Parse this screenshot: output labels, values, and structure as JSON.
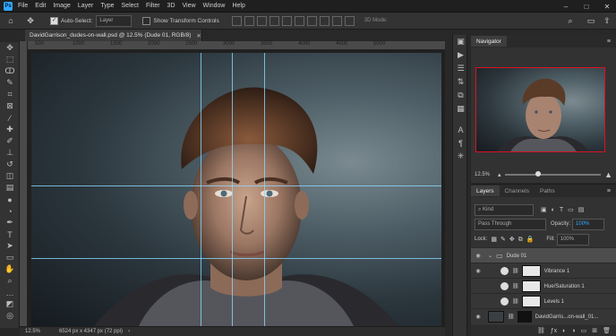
{
  "menu": {
    "items": [
      "File",
      "Edit",
      "Image",
      "Layer",
      "Type",
      "Select",
      "Filter",
      "3D",
      "View",
      "Window",
      "Help"
    ]
  },
  "options": {
    "auto_select_label": "Auto-Select:",
    "auto_select_value": "Layer",
    "transform_label": "Show Transform Controls",
    "mode_3d": "3D Mode:"
  },
  "document": {
    "tab_title": "DavidGarrison_dudes-on-wall.psd @ 12.5% (Dude 01, RGB/8)",
    "ruler_labels": [
      "500",
      "1000",
      "1500",
      "2000",
      "2500",
      "3000",
      "3500",
      "4000",
      "4500",
      "5000"
    ],
    "zoom": "12.5%",
    "dimensions": "6524 px x 4347 px (72 ppi)"
  },
  "navigator": {
    "tab_label": "Navigator",
    "zoom": "12.5%"
  },
  "layers": {
    "tabs": [
      "Layers",
      "Channels",
      "Paths"
    ],
    "filter_kind": "Kind",
    "blend_mode": "Pass Through",
    "opacity_label": "Opacity:",
    "opacity_value": "100%",
    "lock_label": "Lock:",
    "fill_label": "Fill:",
    "fill_value": "100%",
    "items": [
      {
        "name": "Dude 01"
      },
      {
        "name": "Vibrance 1"
      },
      {
        "name": "Hue/Saturation 1"
      },
      {
        "name": "Levels 1"
      },
      {
        "name": "DavidGarris...on-wall_01..."
      }
    ]
  },
  "colors": {
    "accent": "#31a8ff",
    "guide": "#8bd7ff"
  }
}
